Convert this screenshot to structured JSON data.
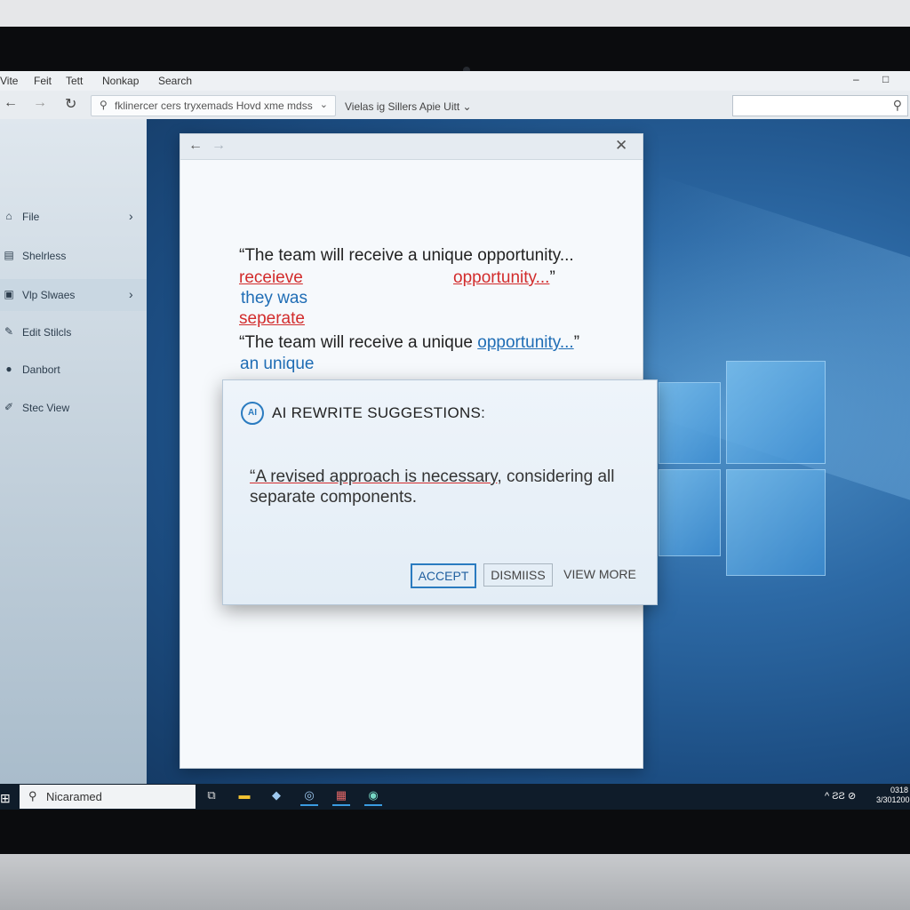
{
  "menu": {
    "items": [
      "Vite",
      "Feit",
      "Tett",
      "Nonkap",
      "Search"
    ]
  },
  "toolbar": {
    "address_text": "fklinercer cers tryxemads Hovd xme mdss",
    "view_selector": "Vielas ig Sillers Apie Uitt"
  },
  "sidebar": {
    "items": [
      {
        "label": "File",
        "icon": "home-icon",
        "has_arrow": true
      },
      {
        "label": "Shelrless",
        "icon": "folder-icon",
        "has_arrow": false
      },
      {
        "label": "Vlp Slwaes",
        "icon": "window-icon",
        "has_arrow": true,
        "active": true
      },
      {
        "label": "Edit Stilcls",
        "icon": "edit-icon",
        "has_arrow": false
      },
      {
        "label": "Danbort",
        "icon": "person-icon",
        "has_arrow": false
      },
      {
        "label": "Stec View",
        "icon": "pen-icon",
        "has_arrow": false
      }
    ]
  },
  "document": {
    "line1": "“The team will receive a unique opportunity...",
    "err_receieve": "receieve",
    "err_opportunity": "opportunity...",
    "err_opportunity_quote": "”",
    "sugg_they_was": "they was",
    "err_seperate": "seperate",
    "line5_prefix": "“The team will receive a unique ",
    "line5_link": "opportunity...",
    "line5_suffix": "”",
    "sugg_an_unique": "an unique"
  },
  "popup": {
    "badge": "AI",
    "title": "AI REWRITE SUGGESTIONS:",
    "suggestion_underlined": "“A revised approach is necessary",
    "suggestion_rest": ", considering all separate components.",
    "accept_label": "ACCEPT",
    "dismiss_label": "DISMIISS",
    "more_label": "VIEW MORE"
  },
  "taskbar": {
    "search_text": "Nicaramed",
    "tray_text": "^ ƧƧ ⊘",
    "clock_line1": "0318",
    "clock_line2": "3/301200"
  },
  "colors": {
    "error_red": "#d22c2c",
    "suggestion_blue": "#1f6db5",
    "accent": "#2a7bc0"
  }
}
